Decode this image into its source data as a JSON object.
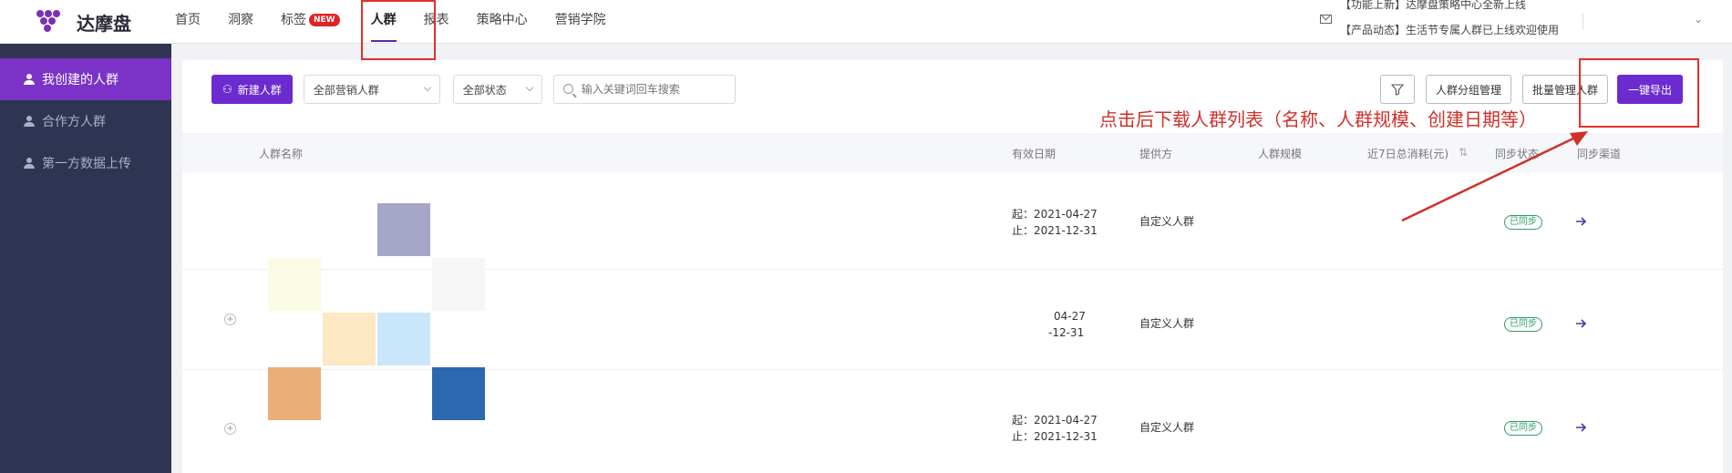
{
  "app": {
    "name": "达摩盘"
  },
  "nav": [
    {
      "label": "首页"
    },
    {
      "label": "洞察"
    },
    {
      "label": "标签",
      "badge": "NEW"
    },
    {
      "label": "人群",
      "active": true
    },
    {
      "label": "报表"
    },
    {
      "label": "策略中心"
    },
    {
      "label": "营销学院"
    }
  ],
  "notice": {
    "line1": "【功能上新】达摩盘策略中心全新上线",
    "line2": "【产品动态】生活节专属人群已上线欢迎使用"
  },
  "sidebar": {
    "items": [
      {
        "label": "我创建的人群",
        "active": true
      },
      {
        "label": "合作方人群"
      },
      {
        "label": "第一方数据上传"
      }
    ]
  },
  "toolbar": {
    "new_button": "新建人群",
    "filter_scope": "全部营销人群",
    "filter_status": "全部状态",
    "search_placeholder": "输入关键词回车搜索",
    "group_manage": "人群分组管理",
    "batch_manage": "批量管理人群",
    "export_button": "一键导出"
  },
  "annotation": "点击后下载人群列表（名称、人群规模、创建日期等）",
  "table": {
    "columns": [
      "人群名称",
      "有效日期",
      "提供方",
      "人群规模",
      "近7日总消耗(元)",
      "同步状态",
      "同步渠道"
    ],
    "rows": [
      {
        "start": "起：2021-04-27",
        "end": "止：2021-12-31",
        "provider": "自定义人群",
        "status": "已同步"
      },
      {
        "start": "04-27",
        "end": "-12-31",
        "provider": "自定义人群",
        "status": "已同步"
      },
      {
        "start": "起：2021-04-27",
        "end": "止：2021-12-31",
        "provider": "自定义人群",
        "status": "已同步"
      }
    ]
  },
  "colors": {
    "accent": "#6b2bd1",
    "sidebar_bg": "#2e3451",
    "annotation_red": "#d0302a",
    "sync_green": "#2f9e6a"
  }
}
